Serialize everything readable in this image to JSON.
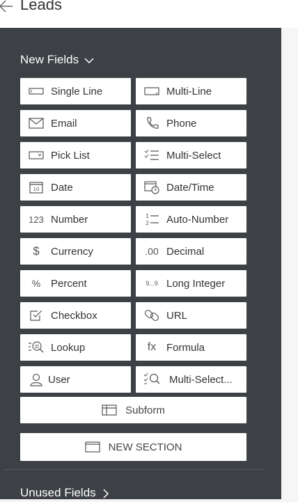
{
  "header": {
    "title": "Leads"
  },
  "new_fields": {
    "label": "New Fields",
    "items": [
      {
        "label": "Single Line",
        "icon": "single-line-icon"
      },
      {
        "label": "Multi-Line",
        "icon": "multi-line-icon"
      },
      {
        "label": "Email",
        "icon": "email-icon"
      },
      {
        "label": "Phone",
        "icon": "phone-icon"
      },
      {
        "label": "Pick List",
        "icon": "pick-list-icon"
      },
      {
        "label": "Multi-Select",
        "icon": "multi-select-icon"
      },
      {
        "label": "Date",
        "icon": "date-icon"
      },
      {
        "label": "Date/Time",
        "icon": "date-time-icon"
      },
      {
        "label": "Number",
        "icon": "number-icon",
        "glyph": "123"
      },
      {
        "label": "Auto-Number",
        "icon": "auto-number-icon"
      },
      {
        "label": "Currency",
        "icon": "currency-icon",
        "glyph": "$"
      },
      {
        "label": "Decimal",
        "icon": "decimal-icon",
        "glyph": ".00"
      },
      {
        "label": "Percent",
        "icon": "percent-icon",
        "glyph": "%"
      },
      {
        "label": "Long Integer",
        "icon": "long-integer-icon",
        "glyph": "9...9"
      },
      {
        "label": "Checkbox",
        "icon": "checkbox-icon"
      },
      {
        "label": "URL",
        "icon": "link-icon"
      },
      {
        "label": "Lookup",
        "icon": "lookup-icon"
      },
      {
        "label": "Formula",
        "icon": "formula-icon",
        "glyph": "fx"
      },
      {
        "label": "User",
        "icon": "user-icon"
      },
      {
        "label": "Multi-Select...",
        "icon": "multi-select-lookup-icon"
      }
    ],
    "subform_label": "Subform",
    "new_section_label": "NEW SECTION"
  },
  "unused_fields": {
    "label": "Unused Fields"
  }
}
